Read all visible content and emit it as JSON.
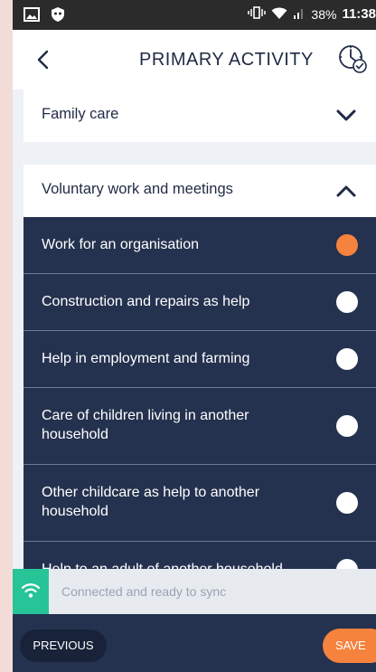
{
  "status_bar": {
    "battery_percent": "38%",
    "time": "11:38"
  },
  "header": {
    "title": "PRIMARY ACTIVITY",
    "back_icon": "chevron-left-icon",
    "clock_icon": "clock-check-icon"
  },
  "categories": [
    {
      "label": "Family care",
      "expanded": false
    },
    {
      "label": "Voluntary work and meetings",
      "expanded": true
    }
  ],
  "activities": [
    {
      "label": "Work for an organisation",
      "selected": true
    },
    {
      "label": "Construction and repairs as help",
      "selected": false
    },
    {
      "label": "Help in employment and farming",
      "selected": false
    },
    {
      "label": "Care of children living in another household",
      "selected": false
    },
    {
      "label": "Other childcare as help to another household",
      "selected": false
    },
    {
      "label": "Help to an adult of another household",
      "selected": false
    }
  ],
  "sync": {
    "status_text": "Connected and ready to sync"
  },
  "footer": {
    "previous_label": "PREVIOUS",
    "save_label": "SAVE"
  },
  "colors": {
    "navy": "#24324f",
    "accent_orange": "#f5823d",
    "sync_green": "#27c498"
  }
}
